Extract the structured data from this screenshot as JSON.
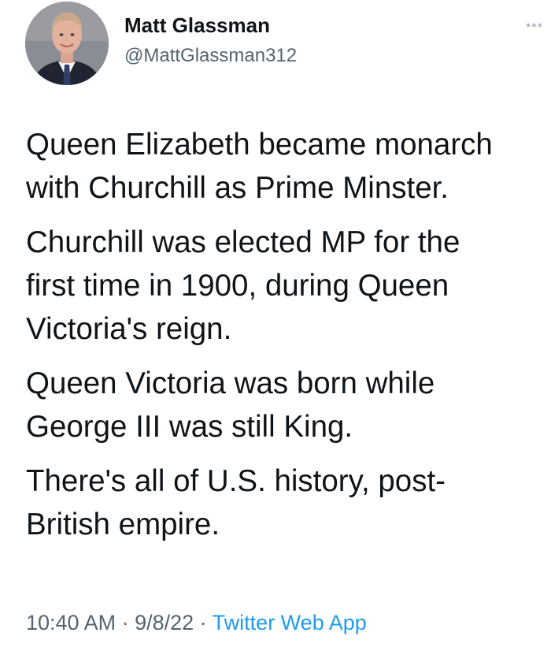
{
  "author": {
    "display_name": "Matt Glassman",
    "handle": "@MattGlassman312"
  },
  "tweet": {
    "paragraphs": [
      "Queen Elizabeth became monarch\nwith Churchill as Prime Minster.",
      "Churchill was elected MP for the\nfirst time in 1900, during Queen\nVictoria's reign.",
      "Queen Victoria was born while\nGeorge III was still King.",
      "There's all of U.S. history, post-\nBritish empire."
    ]
  },
  "meta": {
    "time": "10:40 AM",
    "separator": " · ",
    "date": "9/8/22",
    "source": "Twitter Web App"
  },
  "icons": {
    "more": "more-options-icon",
    "avatar": "profile-photo"
  },
  "colors": {
    "text": "#0f1419",
    "secondary": "#536471",
    "link": "#1d9bf0"
  }
}
